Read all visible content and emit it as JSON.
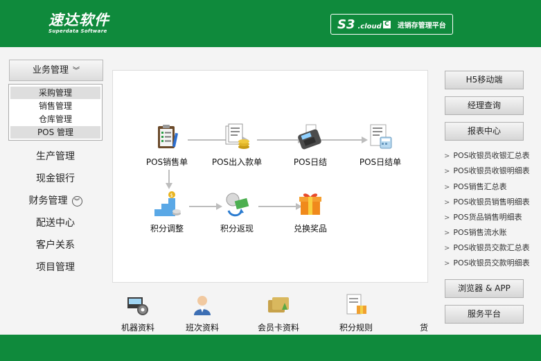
{
  "header": {
    "logo_text": "速达软件",
    "logo_sub": "Superdata Software",
    "badge_s3": "S3",
    "badge_cloud": ".cloud",
    "badge_c": "C",
    "badge_title": "进销存管理平台"
  },
  "sidebar": {
    "business_label": "业务管理",
    "submenu": [
      {
        "label": "采购管理"
      },
      {
        "label": "销售管理"
      },
      {
        "label": "仓库管理"
      },
      {
        "label": "POS 管理"
      }
    ],
    "menu": [
      {
        "label": "生产管理"
      },
      {
        "label": "现金银行"
      },
      {
        "label": "财务管理"
      },
      {
        "label": "配送中心"
      },
      {
        "label": "客户关系"
      },
      {
        "label": "项目管理"
      }
    ]
  },
  "flow": {
    "pos_sales": "POS销售单",
    "pos_cash": "POS出入款单",
    "pos_daily": "POS日结",
    "pos_daily_bill": "POS日结单",
    "points_adjust": "积分调整",
    "points_return": "积分返现",
    "redeem_prize": "兑换奖品"
  },
  "tools": [
    {
      "label": "机器资料"
    },
    {
      "label": "班次资料"
    },
    {
      "label": "会员卡资料"
    },
    {
      "label": "积分规则"
    },
    {
      "label": "货品"
    }
  ],
  "right": {
    "h5": "H5移动端",
    "manager_query": "经理查询",
    "report_center": "报表中心",
    "reports": [
      {
        "label": "POS收银员收银汇总表"
      },
      {
        "label": "POS收银员收银明细表"
      },
      {
        "label": "POS销售汇总表"
      },
      {
        "label": "POS收银员销售明细表"
      },
      {
        "label": "POS货品销售明细表"
      },
      {
        "label": "POS销售流水账"
      },
      {
        "label": "POS收银员交款汇总表"
      },
      {
        "label": "POS收银员交款明细表"
      }
    ],
    "browser_app": "浏览器 & APP",
    "service": "服务平台"
  },
  "colors": {
    "brand_green": "#0f8a3c",
    "highlight": "#dedede"
  }
}
